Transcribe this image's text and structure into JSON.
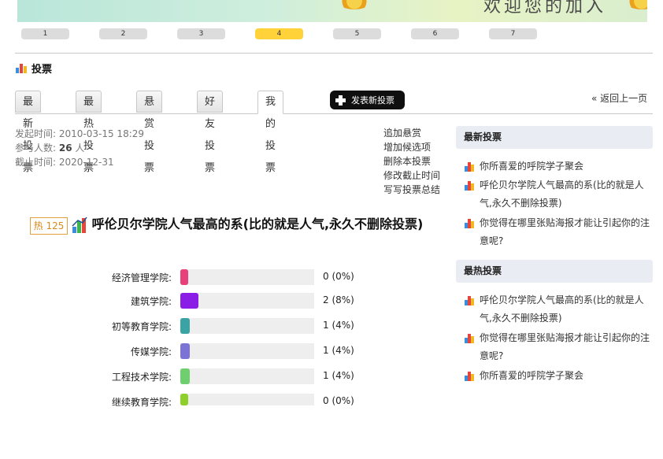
{
  "pager": {
    "pages": [
      "1",
      "2",
      "3",
      "4",
      "5",
      "6",
      "7"
    ],
    "active_index": 3
  },
  "header": {
    "title": "投票"
  },
  "tabs": [
    {
      "label": "最新投票",
      "active": false
    },
    {
      "label": "最热投票",
      "active": false
    },
    {
      "label": "悬赏投票",
      "active": false
    },
    {
      "label": "好友投票",
      "active": false
    },
    {
      "label": "我的投票",
      "active": true
    }
  ],
  "new_vote_button": "发表新投票",
  "back_link": "« 返回上一页",
  "meta": {
    "start_label": "发起时间:",
    "start_value": "2010-03-15 18:29",
    "participants_label": "参与人数:",
    "participants_value": "26",
    "participants_unit": "人",
    "end_label": "截止时间:",
    "end_value": "2020-12-31"
  },
  "actions": [
    "追加悬赏",
    "增加候选项",
    "删除本投票",
    "修改截止时间",
    "写写投票总结"
  ],
  "poll": {
    "hot_label": "热 125",
    "title": "呼伦贝尔学院人气最高的系(比的就是人气,永久不删除投票)",
    "options": [
      {
        "label": "经济管理学院:",
        "result": "0 (0%)",
        "percent": 0,
        "color": "#e8407a"
      },
      {
        "label": "建筑学院:",
        "result": "2 (8%)",
        "percent": 8,
        "color": "#8a1ee6"
      },
      {
        "label": "初等教育学院:",
        "result": "1 (4%)",
        "percent": 4,
        "color": "#3aa3a3"
      },
      {
        "label": "传媒学院:",
        "result": "1 (4%)",
        "percent": 4,
        "color": "#7b74d6"
      },
      {
        "label": "工程技术学院:",
        "result": "1 (4%)",
        "percent": 4,
        "color": "#6fcf6f"
      },
      {
        "label": "继续教育学院:",
        "result": "0 (0%)",
        "percent": 0,
        "color": "#8fcf2a"
      }
    ]
  },
  "sidebar": {
    "latest": {
      "title": "最新投票",
      "items": [
        "你所喜爱的呼院学子聚会",
        "呼伦贝尔学院人气最高的系(比的就是人气,永久不删除投票)",
        "你觉得在哪里张贴海报才能让引起你的注意呢?"
      ]
    },
    "hottest": {
      "title": "最热投票",
      "items": [
        "呼伦贝尔学院人气最高的系(比的就是人气,永久不删除投票)",
        "你觉得在哪里张贴海报才能让引起你的注意呢?",
        "你所喜爱的呼院学子聚会"
      ]
    }
  },
  "colors": {
    "accent": "#ffd23a",
    "hot": "#d98a1a",
    "panel": "#e9edf3"
  }
}
